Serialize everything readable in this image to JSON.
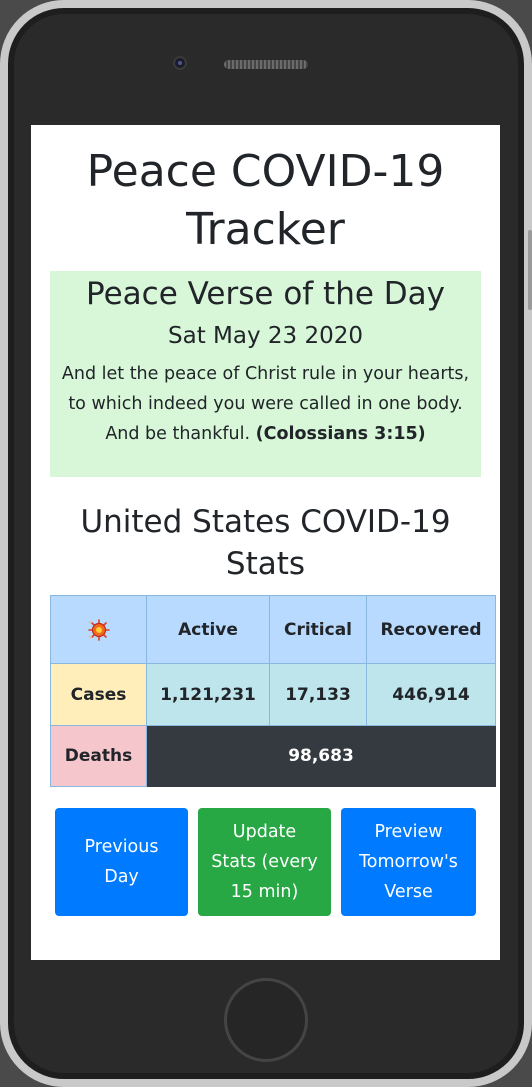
{
  "page": {
    "title": "Peace COVID-19 Tracker"
  },
  "verse": {
    "heading": "Peace Verse of the Day",
    "date": "Sat May 23 2020",
    "text": "And let the peace of Christ rule in your hearts, to which indeed you were called in one body. And be thankful.",
    "reference": "(Colossians 3:15)"
  },
  "stats": {
    "heading": "United States COVID-19 Stats",
    "icon": "virus-icon",
    "columns": [
      "Active",
      "Critical",
      "Recovered"
    ],
    "rows": {
      "cases": {
        "label": "Cases",
        "active": "1,121,231",
        "critical": "17,133",
        "recovered": "446,914"
      },
      "deaths": {
        "label": "Deaths",
        "value": "98,683"
      }
    }
  },
  "buttons": {
    "previous": "Previous Day",
    "update": "Update Stats (every 15 min)",
    "preview": "Preview Tomorrow's Verse"
  },
  "colors": {
    "verse_bg": "#d8f7d8",
    "header_bg": "#b8dafe",
    "cases_bg": "#bee5eb",
    "cases_label_bg": "#ffeeba",
    "deaths_label_bg": "#f5c6cb",
    "deaths_value_bg": "#343a40",
    "primary": "#007bff",
    "success": "#28a745"
  }
}
